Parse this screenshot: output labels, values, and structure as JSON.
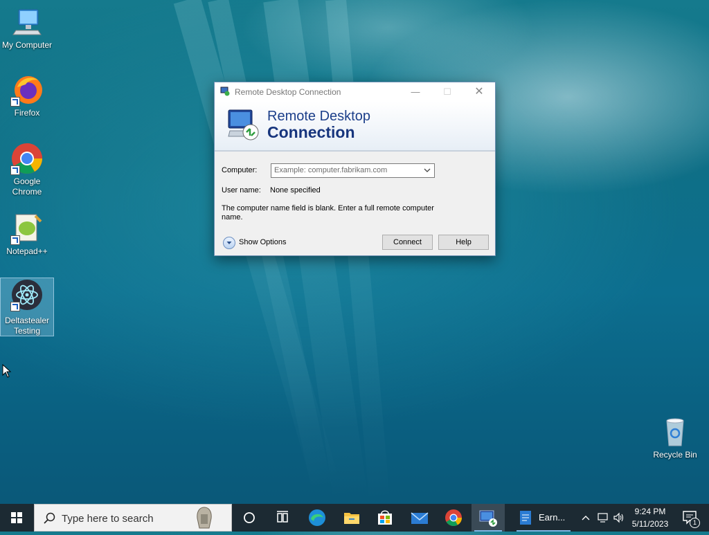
{
  "desktop": {
    "icons": [
      {
        "label": "My Computer",
        "icon": "computer-icon"
      },
      {
        "label": "Firefox",
        "icon": "firefox-icon"
      },
      {
        "label": "Google Chrome",
        "icon": "chrome-icon"
      },
      {
        "label": "Notepad++",
        "icon": "notepadpp-icon"
      },
      {
        "label": "Deltastealer Testing",
        "icon": "electron-icon"
      }
    ],
    "recycle_bin": {
      "label": "Recycle Bin",
      "icon": "recycle-bin-icon"
    }
  },
  "dialog": {
    "title": "Remote Desktop Connection",
    "banner_line1": "Remote Desktop",
    "banner_line2": "Connection",
    "computer_label": "Computer:",
    "computer_placeholder": "Example: computer.fabrikam.com",
    "username_label": "User name:",
    "username_value": "None specified",
    "message": "The computer name field is blank. Enter a full remote computer name.",
    "show_options": "Show Options",
    "connect": "Connect",
    "help": "Help"
  },
  "taskbar": {
    "search_placeholder": "Type here to search",
    "pinned": [
      "start-icon",
      "cortana-icon",
      "task-view-icon",
      "edge-icon",
      "file-explorer-icon",
      "store-icon",
      "mail-icon",
      "chrome-icon",
      "remote-desktop-icon"
    ],
    "open_app_label": "Earn...",
    "time": "9:24 PM",
    "date": "5/11/2023",
    "notification_count": "1"
  },
  "colors": {
    "accent": "#1c3f8a",
    "taskbar": "#1c2a33",
    "desktop": "#0f6f86"
  }
}
